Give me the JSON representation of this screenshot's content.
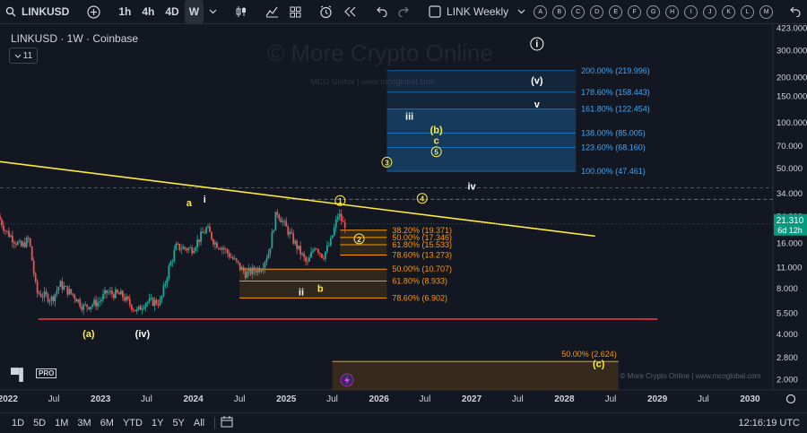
{
  "toolbar": {
    "symbol": "LINKUSD",
    "intervals": [
      "1h",
      "4h",
      "4D",
      "W"
    ],
    "active_interval": "W",
    "layout_name": "LINK Weekly",
    "alert_letters": [
      "A",
      "B",
      "C",
      "D",
      "E",
      "F",
      "G",
      "H",
      "I",
      "J",
      "K",
      "L",
      "M"
    ]
  },
  "legend": {
    "title": "LINKUSD · 1W · Coinbase",
    "count": "11"
  },
  "watermark": {
    "main": "© More Crypto Online",
    "sub": "MCO Global   |   www.mcoglobal.com",
    "footer": "© More Crypto Online  |  www.mcoglobal.com"
  },
  "tv_logo_badge": "PRO",
  "bottombar": {
    "ranges": [
      "1D",
      "5D",
      "1M",
      "3M",
      "6M",
      "YTD",
      "1Y",
      "5Y",
      "All"
    ],
    "clock": "12:16:19 UTC"
  },
  "colors": {
    "up": "#26a69a",
    "down": "#ef5350",
    "trendline": "#ffeb3b",
    "fib_orange": "#ff9800",
    "fib_blue": "#2196f3",
    "support": "#f23645",
    "price_badge": "#089981"
  },
  "chart_data": {
    "type": "candlestick",
    "symbol": "LINKUSD",
    "timeframe": "1W",
    "exchange": "Coinbase",
    "y_scale": "log",
    "ylim": [
      1.7,
      440
    ],
    "y_ticks": [
      423,
      300,
      200,
      150,
      100,
      70,
      50,
      34,
      24,
      16,
      11,
      8,
      5.5,
      4,
      2.8,
      2
    ],
    "x_range": [
      "2021-12-01",
      "2030-04-01"
    ],
    "x_ticks": [
      {
        "label": "2022",
        "date": "2022-01-01"
      },
      {
        "label": "Jul",
        "date": "2022-07-01"
      },
      {
        "label": "2023",
        "date": "2023-01-01"
      },
      {
        "label": "Jul",
        "date": "2023-07-01"
      },
      {
        "label": "2024",
        "date": "2024-01-01"
      },
      {
        "label": "Jul",
        "date": "2024-07-01"
      },
      {
        "label": "2025",
        "date": "2025-01-01"
      },
      {
        "label": "Jul",
        "date": "2025-07-01"
      },
      {
        "label": "2026",
        "date": "2026-01-01"
      },
      {
        "label": "Jul",
        "date": "2026-07-01"
      },
      {
        "label": "2027",
        "date": "2027-01-01"
      },
      {
        "label": "Jul",
        "date": "2027-07-01"
      },
      {
        "label": "2028",
        "date": "2028-01-01"
      },
      {
        "label": "Jul",
        "date": "2028-07-01"
      },
      {
        "label": "2029",
        "date": "2029-01-01"
      },
      {
        "label": "Jul",
        "date": "2029-07-01"
      },
      {
        "label": "2030",
        "date": "2030-01-01"
      }
    ],
    "price_path": [
      [
        "2021-12-01",
        24
      ],
      [
        "2022-01-01",
        19
      ],
      [
        "2022-03-01",
        15
      ],
      [
        "2022-04-01",
        17
      ],
      [
        "2022-05-01",
        7.5
      ],
      [
        "2022-07-01",
        6.8
      ],
      [
        "2022-08-01",
        8.5
      ],
      [
        "2022-10-01",
        7
      ],
      [
        "2022-11-01",
        6
      ],
      [
        "2023-01-01",
        6.5
      ],
      [
        "2023-02-01",
        7.5
      ],
      [
        "2023-04-01",
        7.2
      ],
      [
        "2023-06-01",
        5.6
      ],
      [
        "2023-07-01",
        6.5
      ],
      [
        "2023-09-01",
        6.5
      ],
      [
        "2023-10-01",
        10.5
      ],
      [
        "2023-11-01",
        15
      ],
      [
        "2024-01-01",
        14.5
      ],
      [
        "2024-03-01",
        20
      ],
      [
        "2024-04-01",
        16
      ],
      [
        "2024-05-01",
        15
      ],
      [
        "2024-07-01",
        11.5
      ],
      [
        "2024-08-01",
        10
      ],
      [
        "2024-10-01",
        11
      ],
      [
        "2024-11-01",
        14
      ],
      [
        "2024-12-01",
        26
      ],
      [
        "2025-01-01",
        21
      ],
      [
        "2025-02-01",
        17
      ],
      [
        "2025-04-01",
        11.5
      ],
      [
        "2025-05-01",
        15.5
      ],
      [
        "2025-06-01",
        13
      ],
      [
        "2025-07-01",
        16
      ],
      [
        "2025-08-01",
        25
      ],
      [
        "2025-08-20",
        21.31
      ]
    ],
    "current_price": {
      "value": "21.310",
      "countdown": "6d 12h"
    },
    "trendline": {
      "from": [
        "2021-12-01",
        55
      ],
      "to": [
        "2028-05-01",
        17.7
      ]
    },
    "support_line": {
      "from": [
        "2022-05-01",
        5.0
      ],
      "to": [
        "2029-01-01",
        5.0
      ]
    },
    "dashed_levels": [
      {
        "value": 37,
        "color": "#26a69a",
        "from": "2021-12-01"
      },
      {
        "value": 31,
        "color": "#9598a1",
        "from": "2025-01-01"
      }
    ],
    "fib_zones": [
      {
        "from": "2025-08-01",
        "to": "2026-02-01",
        "levels": [
          {
            "label": "38.20% (19.371)",
            "value": 19.371
          },
          {
            "label": "50.00% (17.346)",
            "value": 17.346
          },
          {
            "label": "61.80% (15.533)",
            "value": 15.533
          },
          {
            "label": "78.60% (13.273)",
            "value": 13.273
          }
        ]
      },
      {
        "from": "2024-07-01",
        "to": "2026-02-01",
        "levels": [
          {
            "label": "50.00% (10.707)",
            "value": 10.707
          },
          {
            "label": "61.80% (8.933)",
            "value": 8.933
          },
          {
            "label": "78.60% (6.902)",
            "value": 6.902
          }
        ]
      }
    ],
    "fib_extension": {
      "from": "2026-02-01",
      "to": "2028-02-15",
      "levels": [
        {
          "label": "200.00% (219.996)",
          "value": 219.996
        },
        {
          "label": "178.60% (158.443)",
          "value": 158.443
        },
        {
          "label": "161.80% (122.454)",
          "value": 122.454
        },
        {
          "label": "138.00% (85.005)",
          "value": 85.005
        },
        {
          "label": "123.60% (68.160)",
          "value": 68.16
        },
        {
          "label": "100.00% (47.461)",
          "value": 47.461
        }
      ]
    },
    "lower_target": {
      "label": "50.00% (2.624)",
      "value": 2.624,
      "from": "2025-07-01",
      "to": "2028-08-01"
    },
    "wave_labels": [
      {
        "text": "a",
        "date": "2023-12-15",
        "value": 28,
        "color": "#ffeb3b"
      },
      {
        "text": "i",
        "date": "2024-02-15",
        "value": 29.5,
        "color": "#ffffff"
      },
      {
        "text": "ii",
        "date": "2025-03-01",
        "value": 7.2,
        "color": "#ffffff"
      },
      {
        "text": "b",
        "date": "2025-05-15",
        "value": 7.6,
        "color": "#ffeb3b"
      },
      {
        "text": "(a)",
        "date": "2022-11-15",
        "value": 3.8,
        "color": "#ffeb3b"
      },
      {
        "text": "(iv)",
        "date": "2023-06-15",
        "value": 3.8,
        "color": "#ffffff"
      },
      {
        "text": "1",
        "date": "2025-08-01",
        "value": 29,
        "color": "#ffeb3b",
        "circled": true
      },
      {
        "text": "2",
        "date": "2025-10-15",
        "value": 16.2,
        "color": "#ffeb3b",
        "circled": true
      },
      {
        "text": "3",
        "date": "2026-02-01",
        "value": 52,
        "color": "#ffeb3b",
        "circled": true
      },
      {
        "text": "4",
        "date": "2026-06-20",
        "value": 30,
        "color": "#ffeb3b",
        "circled": true
      },
      {
        "text": "5",
        "date": "2026-08-15",
        "value": 61,
        "color": "#ffeb3b",
        "circled": true
      },
      {
        "text": "iii",
        "date": "2026-05-01",
        "value": 104,
        "color": "#ffffff"
      },
      {
        "text": "(b)",
        "date": "2026-08-15",
        "value": 85,
        "color": "#ffeb3b"
      },
      {
        "text": "c",
        "date": "2026-08-15",
        "value": 72,
        "color": "#ffeb3b"
      },
      {
        "text": "iv",
        "date": "2027-01-01",
        "value": 36,
        "color": "#ffffff"
      },
      {
        "text": "(v)",
        "date": "2027-09-15",
        "value": 180,
        "color": "#ffffff"
      },
      {
        "text": "v",
        "date": "2027-09-15",
        "value": 125,
        "color": "#ffffff"
      },
      {
        "text": "i",
        "date": "2027-09-15",
        "value": 315,
        "color": "#ffffff",
        "circled": true
      },
      {
        "text": "(c)",
        "date": "2028-05-15",
        "value": 2.4,
        "color": "#ffeb3b"
      }
    ]
  }
}
